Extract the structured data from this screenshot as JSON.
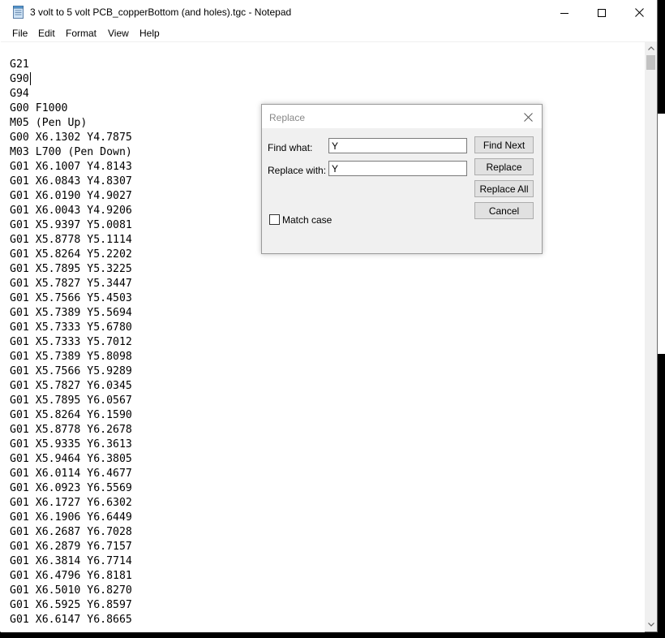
{
  "window": {
    "title": "3 volt to 5 volt PCB_copperBottom (and holes).tgc - Notepad",
    "icon": "notepad-icon",
    "controls": [
      "minimize-icon",
      "maximize-icon",
      "close-icon"
    ]
  },
  "menu": {
    "file": "File",
    "edit": "Edit",
    "format": "Format",
    "view": "View",
    "help": "Help"
  },
  "editor": {
    "lines": [
      "G21",
      "G90",
      "G94",
      "G00 F1000",
      "M05 (Pen Up)",
      "G00 X6.1302 Y4.7875",
      "M03 L700 (Pen Down)",
      "G01 X6.1007 Y4.8143",
      "G01 X6.0843 Y4.8307",
      "G01 X6.0190 Y4.9027",
      "G01 X6.0043 Y4.9206",
      "G01 X5.9397 Y5.0081",
      "G01 X5.8778 Y5.1114",
      "G01 X5.8264 Y5.2202",
      "G01 X5.7895 Y5.3225",
      "G01 X5.7827 Y5.3447",
      "G01 X5.7566 Y5.4503",
      "G01 X5.7389 Y5.5694",
      "G01 X5.7333 Y5.6780",
      "G01 X5.7333 Y5.7012",
      "G01 X5.7389 Y5.8098",
      "G01 X5.7566 Y5.9289",
      "G01 X5.7827 Y6.0345",
      "G01 X5.7895 Y6.0567",
      "G01 X5.8264 Y6.1590",
      "G01 X5.8778 Y6.2678",
      "G01 X5.9335 Y6.3613",
      "G01 X5.9464 Y6.3805",
      "G01 X6.0114 Y6.4677",
      "G01 X6.0923 Y6.5569",
      "G01 X6.1727 Y6.6302",
      "G01 X6.1906 Y6.6449",
      "G01 X6.2687 Y6.7028",
      "G01 X6.2879 Y6.7157",
      "G01 X6.3814 Y6.7714",
      "G01 X6.4796 Y6.8181",
      "G01 X6.5010 Y6.8270",
      "G01 X6.5925 Y6.8597",
      "G01 X6.6147 Y6.8665"
    ]
  },
  "replace_dialog": {
    "title": "Replace",
    "find_label": "Find what:",
    "find_value": "Y",
    "replace_label": "Replace with:",
    "replace_value": "Y",
    "find_next": "Find Next",
    "replace": "Replace",
    "replace_all": "Replace All",
    "cancel": "Cancel",
    "match_case": "Match case",
    "match_case_checked": false
  }
}
